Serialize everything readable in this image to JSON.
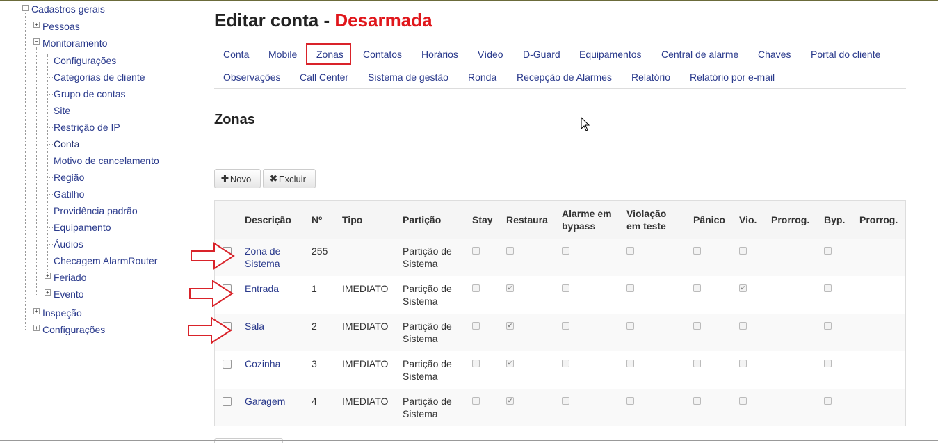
{
  "sidebar": {
    "items": [
      {
        "label": "Cadastros gerais",
        "toggle": "−"
      },
      {
        "label": "Pessoas",
        "toggle": "+"
      },
      {
        "label": "Monitoramento",
        "toggle": "−"
      },
      {
        "label": "Configurações"
      },
      {
        "label": "Categorias de cliente"
      },
      {
        "label": "Grupo de contas"
      },
      {
        "label": "Site"
      },
      {
        "label": "Restrição de IP"
      },
      {
        "label": "Conta"
      },
      {
        "label": "Motivo de cancelamento"
      },
      {
        "label": "Região"
      },
      {
        "label": "Gatilho"
      },
      {
        "label": "Providência padrão"
      },
      {
        "label": "Equipamento"
      },
      {
        "label": "Áudios"
      },
      {
        "label": "Checagem AlarmRouter"
      },
      {
        "label": "Feriado",
        "toggle": "+"
      },
      {
        "label": "Evento",
        "toggle": "+"
      },
      {
        "label": "Inspeção",
        "toggle": "+"
      },
      {
        "label": "Configurações",
        "toggle": "+"
      }
    ]
  },
  "page": {
    "title": "Editar conta - ",
    "status": "Desarmada",
    "status_color": "#e0161b"
  },
  "tabs": {
    "items": [
      {
        "label": "Conta"
      },
      {
        "label": "Mobile"
      },
      {
        "label": "Zonas",
        "active": true
      },
      {
        "label": "Contatos"
      },
      {
        "label": "Horários"
      },
      {
        "label": "Vídeo"
      },
      {
        "label": "D-Guard"
      },
      {
        "label": "Equipamentos"
      },
      {
        "label": "Central de alarme"
      },
      {
        "label": "Chaves"
      },
      {
        "label": "Portal do cliente"
      },
      {
        "label": "Observações"
      },
      {
        "label": "Call Center"
      },
      {
        "label": "Sistema de gestão"
      },
      {
        "label": "Ronda"
      },
      {
        "label": "Recepção de Alarmes"
      },
      {
        "label": "Relatório"
      },
      {
        "label": "Relatório por e-mail"
      }
    ]
  },
  "section": {
    "title": "Zonas"
  },
  "toolbar": {
    "new_label": "Novo",
    "new_icon": "plus-icon",
    "delete_label": "Excluir",
    "delete_icon": "x-icon"
  },
  "table": {
    "headers": [
      {
        "l1": "Descrição",
        "l2": ""
      },
      {
        "l1": "Nº",
        "l2": ""
      },
      {
        "l1": "Tipo",
        "l2": ""
      },
      {
        "l1": "Partição",
        "l2": ""
      },
      {
        "l1": "Stay",
        "l2": ""
      },
      {
        "l1": "Restaura",
        "l2": ""
      },
      {
        "l1": "Alarme em",
        "l2": "bypass"
      },
      {
        "l1": "Violação",
        "l2": "em teste"
      },
      {
        "l1": "Pânico",
        "l2": ""
      },
      {
        "l1": "Vio.",
        "l2": ""
      },
      {
        "l1": "Prorrog.",
        "l2": ""
      },
      {
        "l1": "Byp.",
        "l2": ""
      },
      {
        "l1": "Prorrog.",
        "l2": ""
      }
    ],
    "rows": [
      {
        "desc1": "Zona de",
        "desc2": "Sistema",
        "num": "255",
        "tipo": "",
        "part1": "Partição de",
        "part2": "Sistema",
        "restaura": false,
        "vio": false,
        "marked": true
      },
      {
        "desc1": "Entrada",
        "desc2": "",
        "num": "1",
        "tipo": "IMEDIATO",
        "part1": "Partição de",
        "part2": "Sistema",
        "restaura": true,
        "vio": true,
        "marked": true
      },
      {
        "desc1": "Sala",
        "desc2": "",
        "num": "2",
        "tipo": "IMEDIATO",
        "part1": "Partição de",
        "part2": "Sistema",
        "restaura": true,
        "vio": false,
        "marked": true
      },
      {
        "desc1": "Cozinha",
        "desc2": "",
        "num": "3",
        "tipo": "IMEDIATO",
        "part1": "Partição de",
        "part2": "Sistema",
        "restaura": true,
        "vio": false,
        "marked": false
      },
      {
        "desc1": "Garagem",
        "desc2": "",
        "num": "4",
        "tipo": "IMEDIATO",
        "part1": "Partição de",
        "part2": "Sistema",
        "restaura": true,
        "vio": false,
        "marked": false
      }
    ]
  },
  "colors": {
    "link": "#2a3a8c",
    "highlight": "#d9232a"
  }
}
